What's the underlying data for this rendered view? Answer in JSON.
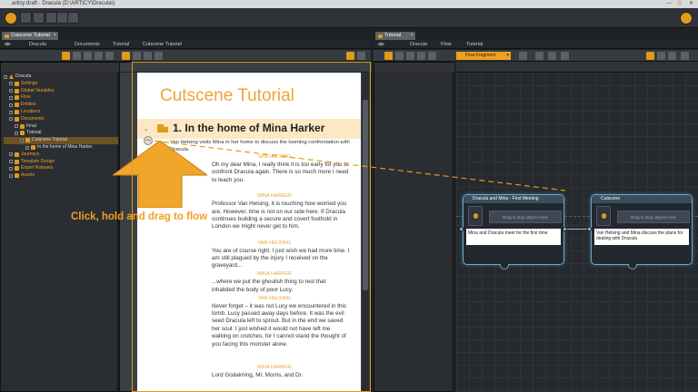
{
  "app": {
    "title": "articy:draft - Dracula (D:\\ARTICY\\Dracula\\)"
  },
  "left_panel": {
    "tab": "Cutscene Tutorial",
    "breadcrumb": [
      "Dracula",
      "Documents",
      "Tutorial",
      "Cutscene Tutorial"
    ],
    "tree": [
      {
        "label": "Dracula",
        "indent": 0,
        "style": "root"
      },
      {
        "label": "Settings",
        "indent": 1,
        "style": "orange"
      },
      {
        "label": "Global Variables",
        "indent": 1,
        "style": "orange"
      },
      {
        "label": "Flow",
        "indent": 1,
        "style": "orange"
      },
      {
        "label": "Entities",
        "indent": 1,
        "style": "orange"
      },
      {
        "label": "Locations",
        "indent": 1,
        "style": "orange"
      },
      {
        "label": "Documents",
        "indent": 1,
        "style": "orange"
      },
      {
        "label": "Final",
        "indent": 2,
        "style": "plain"
      },
      {
        "label": "Tutorial",
        "indent": 2,
        "style": "plain"
      },
      {
        "label": "Cutscene Tutorial",
        "indent": 3,
        "style": "selected"
      },
      {
        "label": "In the home of Mina Harker",
        "indent": 4,
        "style": "plain"
      },
      {
        "label": "Journeys",
        "indent": 1,
        "style": "orange"
      },
      {
        "label": "Template Design",
        "indent": 1,
        "style": "orange"
      },
      {
        "label": "Export Rulesets",
        "indent": 1,
        "style": "orange"
      },
      {
        "label": "Assets",
        "indent": 1,
        "style": "orange"
      }
    ]
  },
  "document": {
    "title": "Cutscene Tutorial",
    "section_number": "1.",
    "section_title": "In the home of Mina Harker",
    "section_desc": "Van Helsing visits Mina in her home to discuss the looming confrontation with Dracula",
    "lines": [
      {
        "speaker": "VAN HELSING",
        "text": "Oh my dear Mina, I really think it is too early for you to confront Dracula again. There is so much more I need to teach you."
      },
      {
        "speaker": "MINA HARKER",
        "text": "Professor Van Helsing, it is touching how worried you are. However, time is not on our side here. If Dracula continues building a secure and covert foothold in London we might never get to him."
      },
      {
        "speaker": "VAN HELSING",
        "text": "You are of course right. I just wish we had more time. I am still plagued by the injury I received on the graveyard..."
      },
      {
        "speaker": "MINA HARKER",
        "text": "...where we put the ghoulish thing to rest that inhabited the body of poor Lucy."
      },
      {
        "speaker": "VAN HELSING",
        "text": "Never forget – it was not Lucy we encountered in this tomb. Lucy passed away days before. It was the evil seed Dracula left to sprout. But in the end we saved her soul. I just wished it would not have left me walking on crutches, for I cannot stand the thought of you facing this monster alone."
      },
      {
        "speaker": "MINA HARKER",
        "text": "Lord Godalming, Mr. Morris, and Dr."
      }
    ]
  },
  "callout": {
    "text": "Click, hold and drag to flow"
  },
  "right_panel": {
    "tab": "Tutorial",
    "breadcrumb": [
      "Dracula",
      "Flow",
      "Tutorial"
    ],
    "flow_dropdown": "Flow Fragment",
    "tree": [
      {
        "label": "Dracula",
        "indent": 0,
        "style": "root"
      },
      {
        "label": "Settings",
        "indent": 1,
        "style": "orange"
      },
      {
        "label": "Global Variables",
        "indent": 1,
        "style": "orange"
      },
      {
        "label": "Flow",
        "indent": 1,
        "style": "orange"
      },
      {
        "label": "Tutorial",
        "indent": 2,
        "style": "selected"
      },
      {
        "label": "Dracula and Mina - First M",
        "indent": 3,
        "style": "plain"
      },
      {
        "label": "Cutscene",
        "indent": 3,
        "style": "plain"
      },
      {
        "label": "Dracula and Mina - First Fi",
        "indent": 3,
        "style": "plain"
      },
      {
        "label": "Final",
        "indent": 2,
        "style": "plain"
      },
      {
        "label": "Entities",
        "indent": 1,
        "style": "orange"
      },
      {
        "label": "Locations",
        "indent": 1,
        "style": "orange"
      },
      {
        "label": "Documents",
        "indent": 1,
        "style": "orange"
      },
      {
        "label": "Journeys",
        "indent": 1,
        "style": "orange"
      },
      {
        "label": "Template Design",
        "indent": 1,
        "style": "orange"
      },
      {
        "label": "Export Rulesets",
        "indent": 1,
        "style": "orange"
      },
      {
        "label": "Assets",
        "indent": 1,
        "style": "orange"
      }
    ],
    "nodes": [
      {
        "title": "Dracula and Mina - First Meeting",
        "drag": "Drag & drop objects here",
        "body": "Mina and Dracula meet for the first time"
      },
      {
        "title": "Cutscene",
        "drag": "Drag & drop objects here",
        "body": "Van Helsing and Mina discuss the plans for dealing with Dracula"
      }
    ]
  },
  "colors": {
    "accent": "#e09a1c",
    "node_border": "#6fa9c7",
    "doc_title": "#f0a33a"
  }
}
